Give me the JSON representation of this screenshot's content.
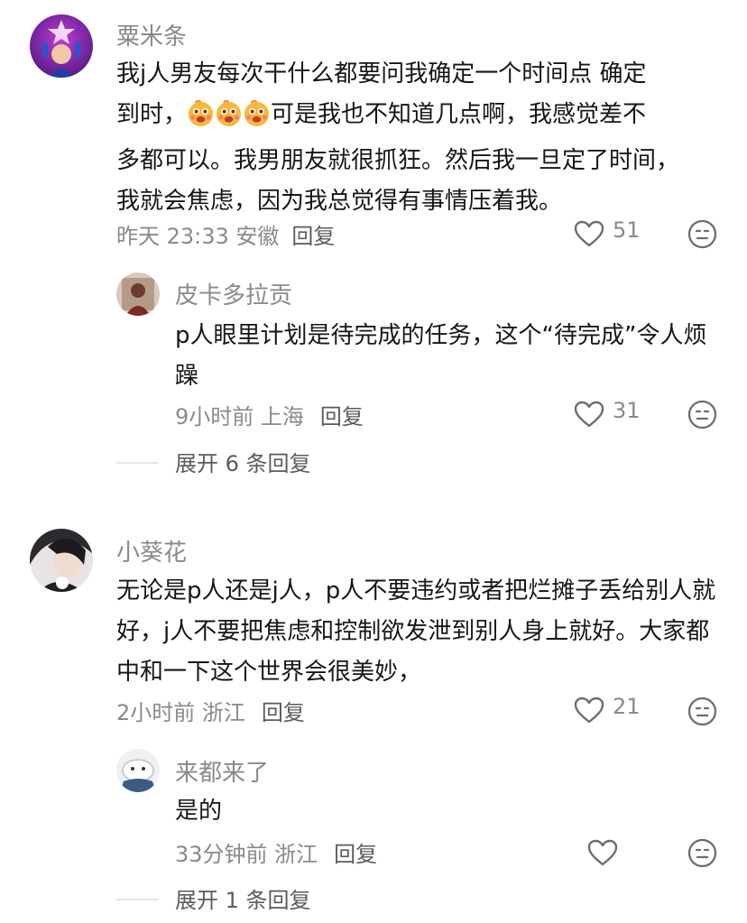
{
  "comments": [
    {
      "username": "粟米条",
      "text_line1": "我j人男友每次干什么都要问我确定一个时间点 确定",
      "text_line2_pre": "到时，",
      "text_line2_post": "可是我也不知道几点啊，我感觉差不",
      "text_rest": "多都可以。我男朋友就很抓狂。然后我一旦定了时间，我就会焦虑，因为我总觉得有事情压着我。",
      "time_location": "昨天 23:33 安徽",
      "reply_label": "回复",
      "likes": "51",
      "emoji_icons": [
        "grinning-emoji-icon",
        "grinning-emoji-icon",
        "grinning-emoji-icon"
      ],
      "replies": [
        {
          "username": "皮卡多拉贡",
          "text": "p人眼里计划是待完成的任务，这个“待完成”令人烦躁",
          "time_location": "9小时前 上海",
          "reply_label": "回复",
          "likes": "31"
        }
      ],
      "expand_label": "展开 6 条回复"
    },
    {
      "username": "小葵花",
      "text": "无论是p人还是j人，p人不要违约或者把烂摊子丢给别人就好，j人不要把焦虑和控制欲发泄到别人身上就好。大家都中和一下这个世界会很美妙，",
      "time_location": "2小时前 浙江",
      "reply_label": "回复",
      "likes": "21",
      "replies": [
        {
          "username": "来都来了",
          "text": "是的",
          "time_location": "33分钟前 浙江",
          "reply_label": "回复",
          "likes": ""
        }
      ],
      "expand_label": "展开 1 条回复"
    }
  ],
  "colors": {
    "text": "#161616",
    "meta": "#8a8a8a",
    "reply": "#5b5b5b",
    "divider": "#e6e6e6"
  }
}
